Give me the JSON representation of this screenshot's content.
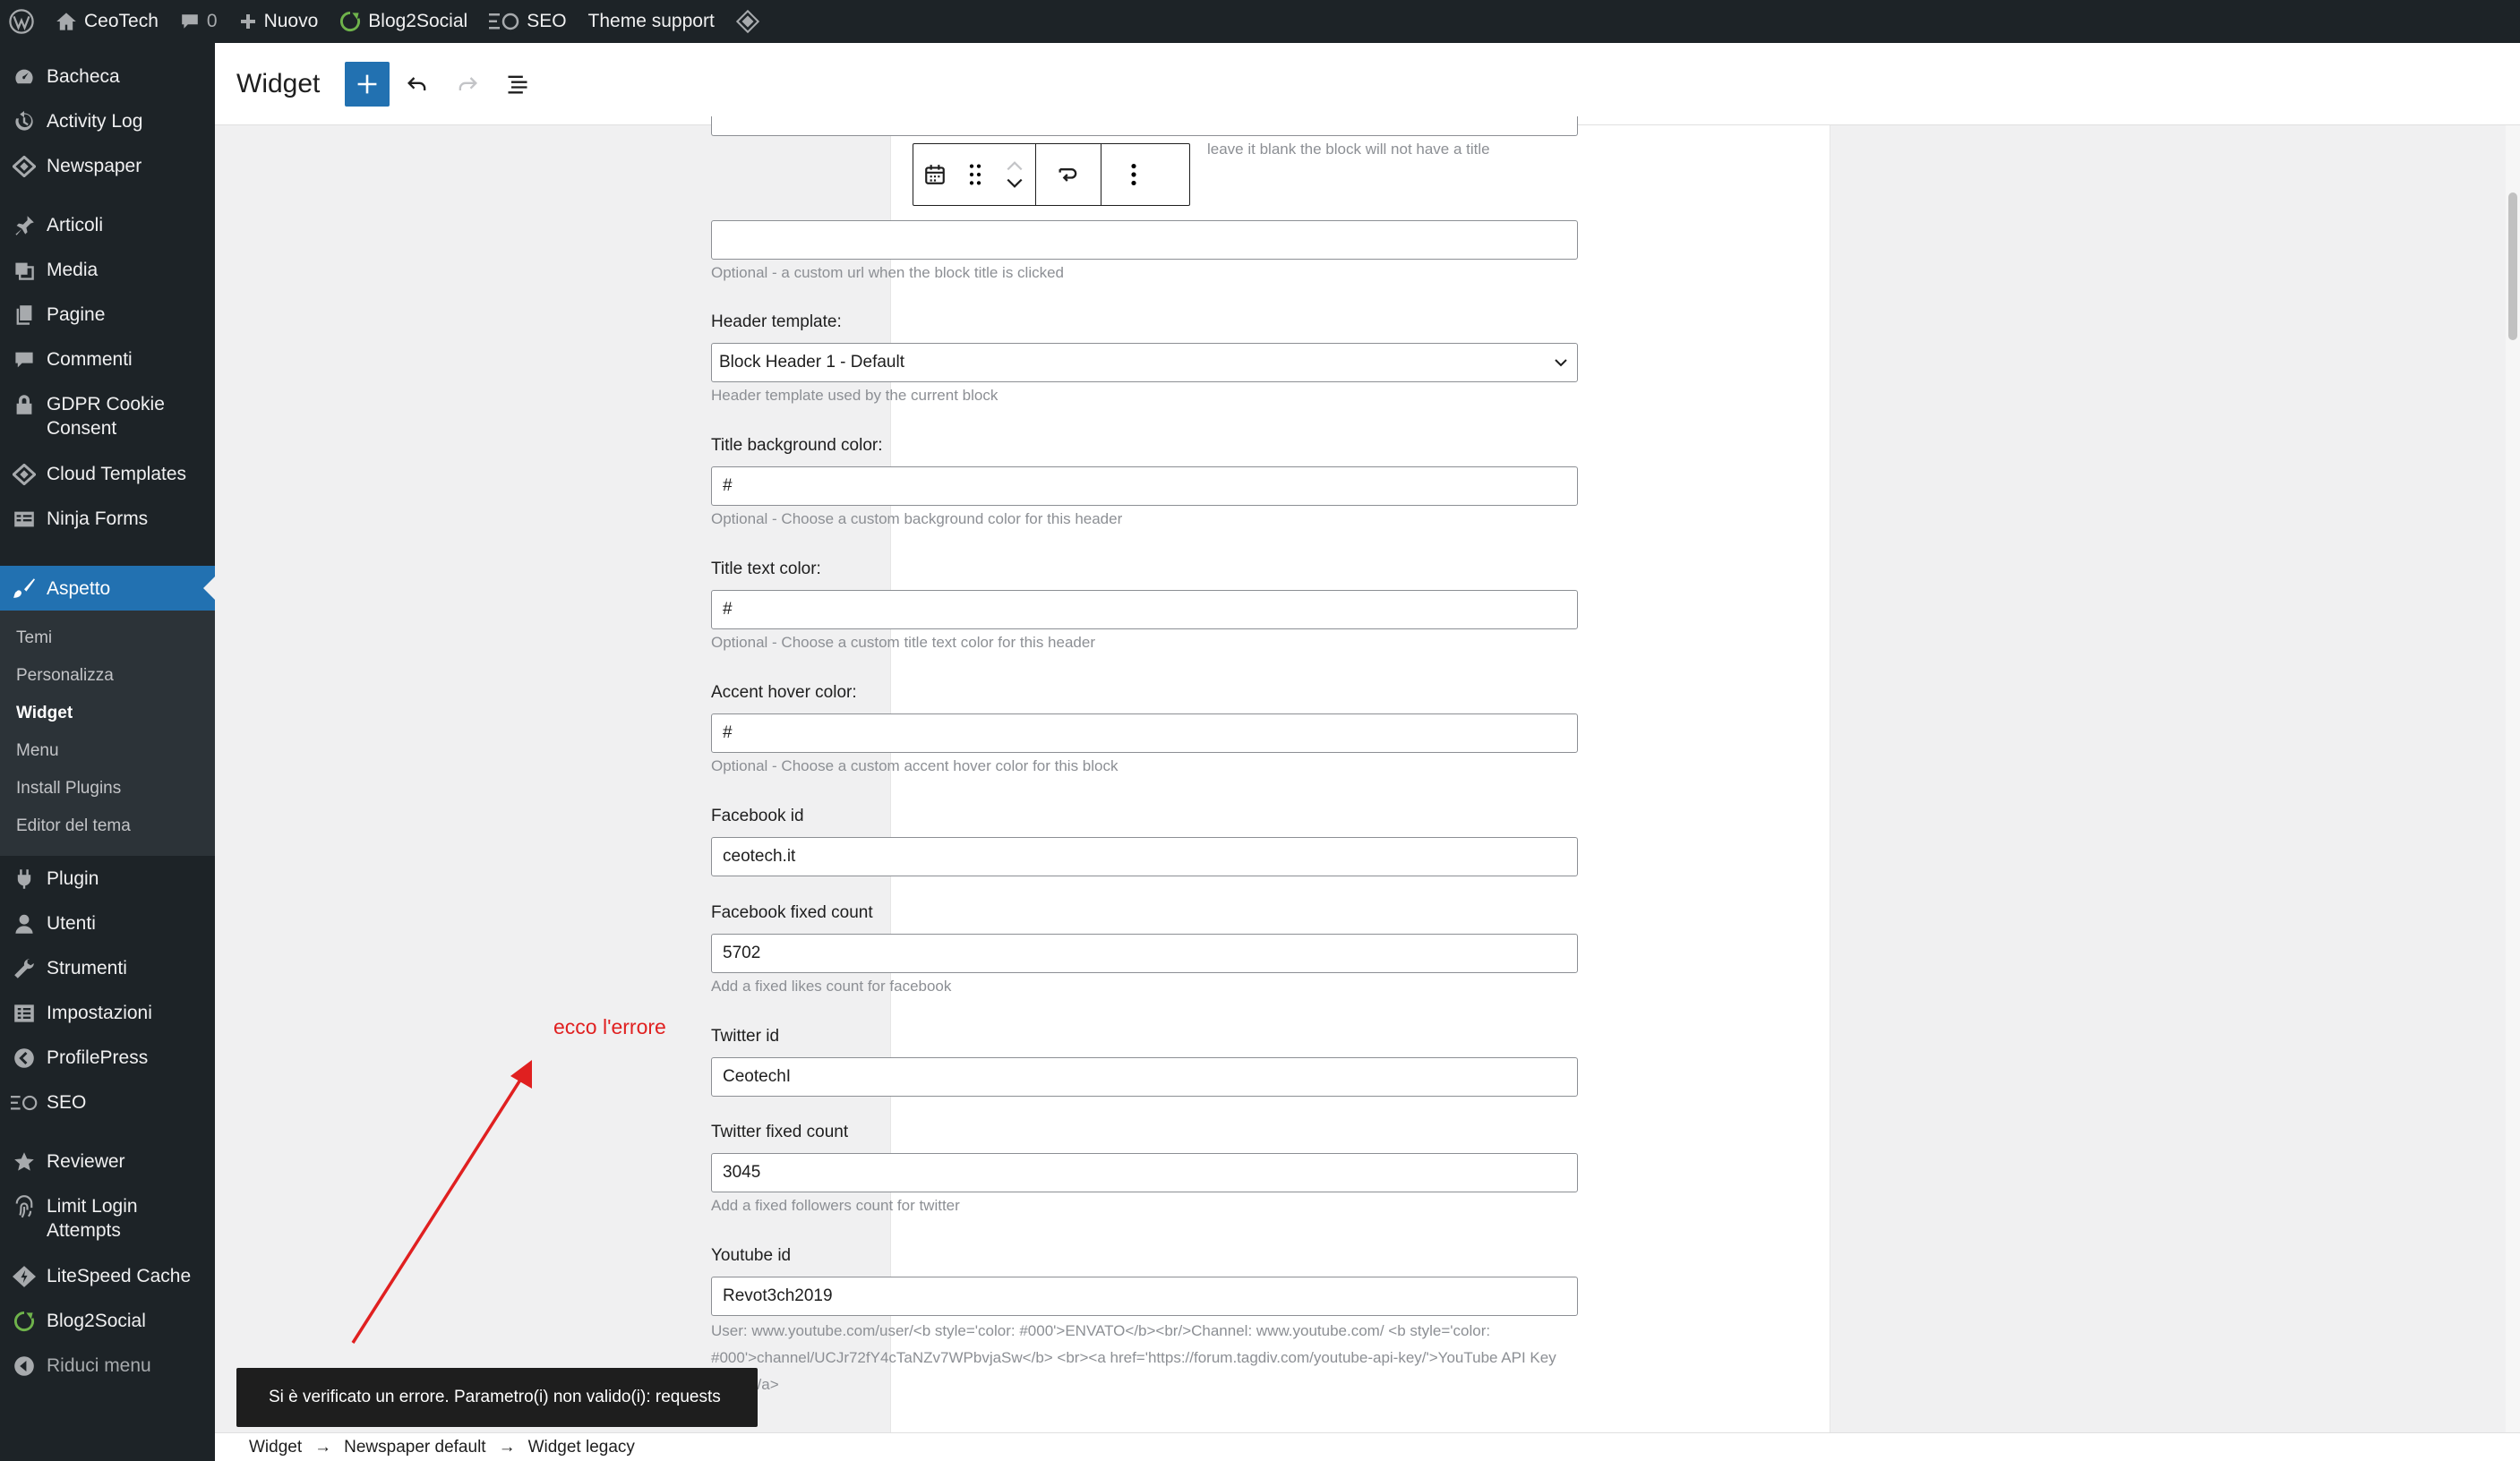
{
  "adminbar": {
    "site_name": "CeoTech",
    "comments_count": "0",
    "new_label": "Nuovo",
    "blog2social_label": "Blog2Social",
    "seo_label": "SEO",
    "theme_support_label": "Theme support"
  },
  "sidebar": {
    "items": [
      {
        "label": "Bacheca",
        "icon": "dashboard-icon"
      },
      {
        "label": "Activity Log",
        "icon": "history-icon"
      },
      {
        "label": "Newspaper",
        "icon": "newspaper-icon"
      },
      {
        "label": "Articoli",
        "icon": "pin-icon"
      },
      {
        "label": "Media",
        "icon": "media-icon"
      },
      {
        "label": "Pagine",
        "icon": "pages-icon"
      },
      {
        "label": "Commenti",
        "icon": "comments-icon"
      },
      {
        "label": "GDPR Cookie\nConsent",
        "icon": "lock-icon"
      },
      {
        "label": "Cloud Templates",
        "icon": "cloud-templates-icon"
      },
      {
        "label": "Ninja Forms",
        "icon": "forms-icon"
      },
      {
        "label": "Aspetto",
        "icon": "paintbrush-icon"
      },
      {
        "label": "Plugin",
        "icon": "plugin-icon"
      },
      {
        "label": "Utenti",
        "icon": "users-icon"
      },
      {
        "label": "Strumenti",
        "icon": "tools-icon"
      },
      {
        "label": "Impostazioni",
        "icon": "settings-icon"
      },
      {
        "label": "ProfilePress",
        "icon": "profilepress-icon"
      },
      {
        "label": "SEO",
        "icon": "seo-icon"
      },
      {
        "label": "Reviewer",
        "icon": "star-icon"
      },
      {
        "label": "Limit Login\nAttempts",
        "icon": "fingerprint-icon"
      },
      {
        "label": "LiteSpeed Cache",
        "icon": "litespeed-icon"
      },
      {
        "label": "Blog2Social",
        "icon": "blog2social-icon"
      },
      {
        "label": "Riduci menu",
        "icon": "collapse-icon"
      }
    ],
    "submenu": [
      "Temi",
      "Personalizza",
      "Widget",
      "Menu",
      "Install Plugins",
      "Editor del tema"
    ]
  },
  "header": {
    "title": "Widget"
  },
  "form": {
    "title_help_fragment": "leave it blank the block will not have a title",
    "url_help": "Optional - a custom url when the block title is clicked",
    "header_template_label": "Header template:",
    "header_template_value": "Block Header 1 - Default",
    "header_template_help": "Header template used by the current block",
    "title_bg_label": "Title background color:",
    "title_bg_value": "#",
    "title_bg_help": "Optional - Choose a custom background color for this header",
    "title_text_label": "Title text color:",
    "title_text_value": "#",
    "title_text_help": "Optional - Choose a custom title text color for this header",
    "accent_label": "Accent hover color:",
    "accent_value": "#",
    "accent_help": "Optional - Choose a custom accent hover color for this block",
    "facebook_id_label": "Facebook id",
    "facebook_id_value": "ceotech.it",
    "facebook_count_label": "Facebook fixed count",
    "facebook_count_value": "5702",
    "facebook_count_help": "Add a fixed likes count for facebook",
    "twitter_id_label": "Twitter id",
    "twitter_id_value": "CeotechI",
    "twitter_count_label": "Twitter fixed count",
    "twitter_count_value": "3045",
    "twitter_count_help": "Add a fixed followers count for twitter",
    "youtube_id_label": "Youtube id",
    "youtube_id_value": "Revot3ch2019",
    "youtube_help": "User: www.youtube.com/user/<b style='color: #000'>ENVATO</b><br/>Channel: www.youtube.com/ <b style='color: #000'>channel/UCJr72fY4cTaNZv7WPbvjaSw</b> <br><a href='https://forum.tagdiv.com/youtube-api-key/'>YouTube API Key guide</a>"
  },
  "annotation": "ecco l'errore",
  "snackbar": "Si è verificato un errore. Parametro(i) non valido(i): requests",
  "breadcrumb": [
    "Widget",
    "Newspaper default",
    "Widget legacy"
  ],
  "breadcrumb_sep": "→"
}
